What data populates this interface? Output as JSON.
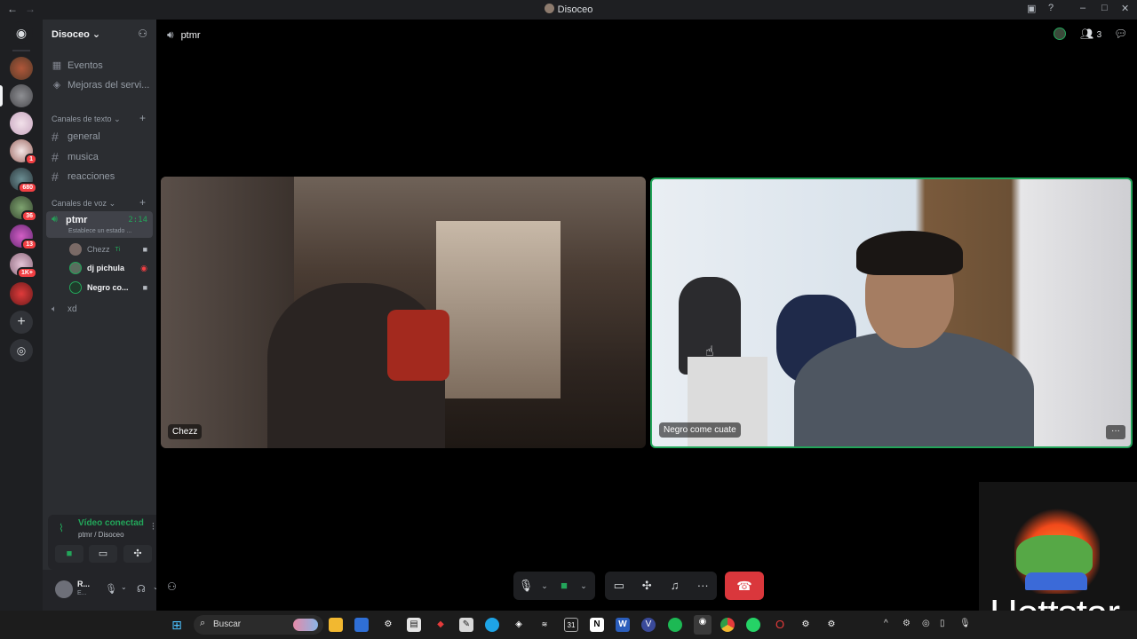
{
  "window": {
    "title": "Disoceo",
    "back": "←",
    "forward": "→"
  },
  "guilds": [
    {
      "name": "server-1",
      "badge": ""
    },
    {
      "name": "server-2",
      "badge": ""
    },
    {
      "name": "server-3",
      "badge": ""
    },
    {
      "name": "server-4",
      "badge": "1"
    },
    {
      "name": "server-5",
      "badge": "680"
    },
    {
      "name": "server-6",
      "badge": "36"
    },
    {
      "name": "server-7",
      "badge": "13"
    },
    {
      "name": "server-8",
      "badge": "1K+"
    },
    {
      "name": "server-9",
      "badge": ""
    }
  ],
  "sidebar": {
    "server_name": "Disoceo",
    "events": "Eventos",
    "boosts": "Mejoras del servi...",
    "text_category": "Canales de texto",
    "text_channels": [
      "general",
      "musica",
      "reacciones"
    ],
    "voice_category": "Canales de voz",
    "voice_channel": {
      "name": "ptmr",
      "time": "2:14",
      "status": "Establece un estado ..."
    },
    "members": [
      {
        "name": "Chezz",
        "extra": "Ti"
      },
      {
        "name": "dj pichula",
        "extra": ""
      },
      {
        "name": "Negro co...",
        "extra": ""
      }
    ],
    "other_voice": "xd"
  },
  "voice_panel": {
    "status": "Vídeo conectad",
    "location": "ptmr / Disoceo"
  },
  "user_panel": {
    "name": "R...",
    "sub": "E..."
  },
  "stage": {
    "channel": "ptmr",
    "participants_count": "3",
    "tiles": [
      {
        "label": "Chezz"
      },
      {
        "label": "Negro come cuate"
      }
    ],
    "more": "···"
  },
  "overlay": {
    "text": "Hottstar"
  },
  "taskbar": {
    "search_placeholder": "Buscar",
    "calendar": "31"
  }
}
